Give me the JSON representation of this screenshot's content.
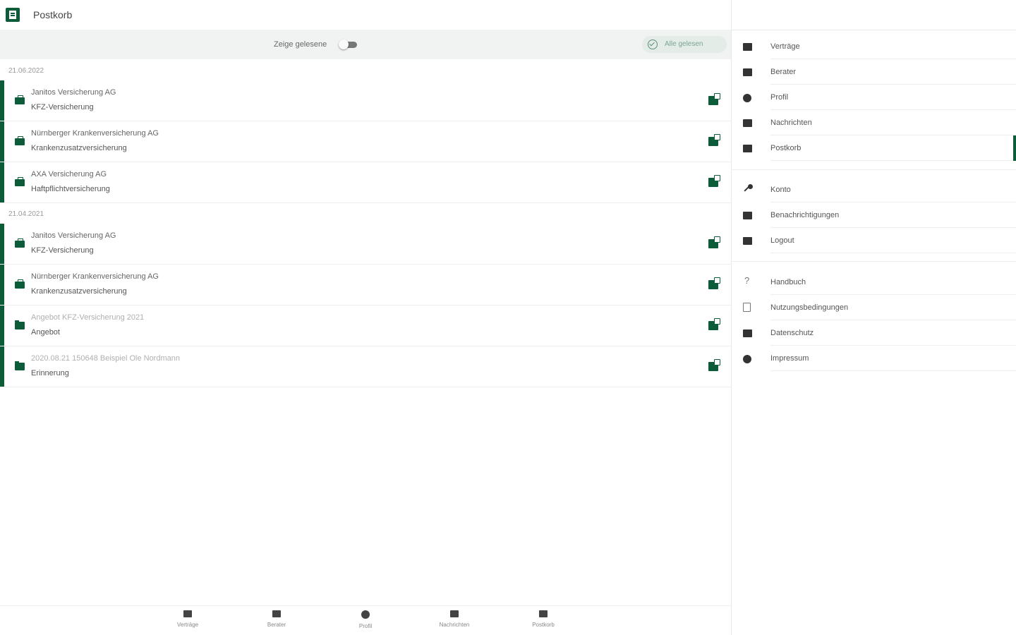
{
  "header": {
    "title": "Postkorb"
  },
  "filter": {
    "show_read_label": "Zeige gelesene",
    "show_read_on": false,
    "all_read_label": "Alle gelesen"
  },
  "groups": [
    {
      "date": "21.06.2022",
      "items": [
        {
          "line1": "Janitos Versicherung AG",
          "line2": "KFZ-Versicherung",
          "icon": "briefcase-icon"
        },
        {
          "line1": "Nürnberger Krankenversicherung AG",
          "line2": "Krankenzusatzversicherung",
          "icon": "briefcase-icon"
        },
        {
          "line1": "AXA Versicherung AG",
          "line2": "Haftpflichtversicherung",
          "icon": "briefcase-icon"
        }
      ]
    },
    {
      "date": "21.04.2021",
      "items": [
        {
          "line1": "Janitos Versicherung AG",
          "line2": "KFZ-Versicherung",
          "icon": "briefcase-icon"
        },
        {
          "line1": "Nürnberger Krankenversicherung AG",
          "line2": "Krankenzusatzversicherung",
          "icon": "briefcase-icon"
        },
        {
          "line1": "Angebot KFZ-Versicherung 2021",
          "line2": "Angebot",
          "icon": "folder-icon"
        },
        {
          "line1": "2020.08.21 150648 Beispiel Ole Nordmann",
          "line2": "Erinnerung",
          "icon": "folder-icon"
        }
      ]
    }
  ],
  "bottom_nav": [
    {
      "label": "Verträge",
      "icon": "briefcase-icon"
    },
    {
      "label": "Berater",
      "icon": "people-icon"
    },
    {
      "label": "Profil",
      "icon": "profile-icon"
    },
    {
      "label": "Nachrichten",
      "icon": "mail-icon"
    },
    {
      "label": "Postkorb",
      "icon": "inbox-icon"
    }
  ],
  "sidebar": {
    "section1": [
      {
        "label": "Verträge",
        "icon": "briefcase-icon"
      },
      {
        "label": "Berater",
        "icon": "people-icon"
      },
      {
        "label": "Profil",
        "icon": "profile-icon"
      },
      {
        "label": "Nachrichten",
        "icon": "mail-icon"
      },
      {
        "label": "Postkorb",
        "icon": "inbox-icon",
        "active": true
      }
    ],
    "section2": [
      {
        "label": "Konto",
        "icon": "key-icon"
      },
      {
        "label": "Benachrichtigungen",
        "icon": "bell-icon"
      },
      {
        "label": "Logout",
        "icon": "logout-icon"
      }
    ],
    "section3": [
      {
        "label": "Handbuch",
        "icon": "help-icon"
      },
      {
        "label": "Nutzungsbedingungen",
        "icon": "document-icon"
      },
      {
        "label": "Datenschutz",
        "icon": "lock-icon"
      },
      {
        "label": "Impressum",
        "icon": "info-icon"
      }
    ]
  },
  "colors": {
    "accent": "#0c5c3a"
  }
}
